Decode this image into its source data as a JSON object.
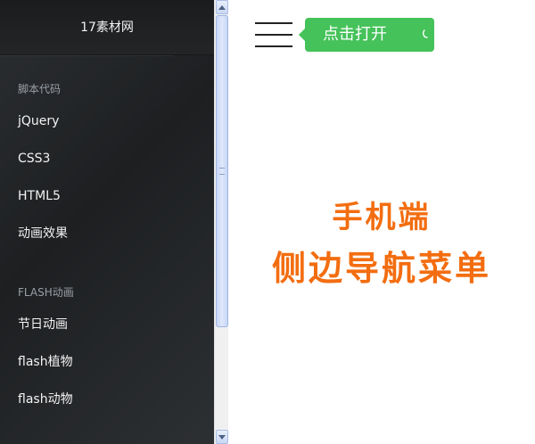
{
  "sidebar": {
    "brand": "17素材网",
    "sections": [
      {
        "title": "脚本代码",
        "items": [
          "jQuery",
          "CSS3",
          "HTML5",
          "动画效果"
        ]
      },
      {
        "title": "FLASH动画",
        "items": [
          "节日动画",
          "flash植物",
          "flash动物"
        ]
      }
    ]
  },
  "main": {
    "tooltip_label": "点击打开",
    "headline_line1": "手机端",
    "headline_line2": "侧边导航菜单"
  },
  "colors": {
    "sidebar_bg": "#26292c",
    "tooltip_green": "#45c25a",
    "headline_orange": "#f36d10"
  },
  "icons": {
    "menu": "hamburger-icon",
    "tap": "tap-hand-icon"
  }
}
